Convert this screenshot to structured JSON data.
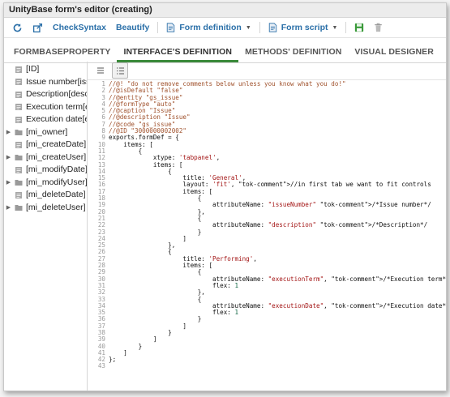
{
  "window": {
    "title": "UnityBase form's editor (creating)"
  },
  "toolbar": {
    "refresh_icon": "refresh-icon",
    "export_icon": "export-icon",
    "check_syntax_label": "CheckSyntax",
    "beautify_label": "Beautify",
    "form_definition_label": "Form definition",
    "form_script_label": "Form script",
    "save_icon": "save-icon",
    "delete_icon": "trash-icon",
    "accent": "#2a6fa8"
  },
  "tabs": [
    {
      "label": "FORMBASEPROPERTY",
      "active": false
    },
    {
      "label": "INTERFACE'S DEFINITION",
      "active": true
    },
    {
      "label": "METHODS' DEFINITION",
      "active": false
    },
    {
      "label": "VISUAL DESIGNER",
      "active": false
    }
  ],
  "tree": {
    "items": [
      {
        "label": "[ID]",
        "expandable": false
      },
      {
        "label": "Issue number[issu",
        "expandable": false
      },
      {
        "label": "Description[descri",
        "expandable": false
      },
      {
        "label": "Execution term[ex",
        "expandable": false
      },
      {
        "label": "Execution date[exe",
        "expandable": false
      },
      {
        "label": "[mi_owner]",
        "expandable": true
      },
      {
        "label": "[mi_createDate]",
        "expandable": false
      },
      {
        "label": "[mi_createUser]",
        "expandable": true
      },
      {
        "label": "[mi_modifyDate]",
        "expandable": false
      },
      {
        "label": "[mi_modifyUser]",
        "expandable": true
      },
      {
        "label": "[mi_deleteDate]",
        "expandable": false
      },
      {
        "label": "[mi_deleteUser]",
        "expandable": true
      }
    ]
  },
  "editor": {
    "code_lines": [
      "//@! \"do not remove comments below unless you know what you do!\"",
      "//@isDefault \"false\"",
      "//@entity \"gs_issue\"",
      "//@formType \"auto\"",
      "//@caption \"Issue\"",
      "//@description \"Issue\"",
      "//@code \"gs_issue\"",
      "//@ID \"3000000002002\"",
      "exports.formDef = {",
      "    items: [",
      "        {",
      "            xtype: 'tabpanel',",
      "            items: [",
      "                {",
      "                    title: 'General',",
      "                    layout: 'fit', //in first tab we want to fit controls",
      "                    items: [",
      "                        {",
      "                            attributeName: \"issueNumber\" /*Issue number*/",
      "                        },",
      "                        {",
      "                            attributeName: \"description\" /*Description*/",
      "                        }",
      "                    ]",
      "                },",
      "                {",
      "                    title: 'Performing',",
      "                    items: [",
      "                        {",
      "                            attributeName: \"executionTerm\", /*Execution term*/",
      "                            flex: 1",
      "                        },",
      "                        {",
      "                            attributeName: \"executionDate\", /*Execution date*/",
      "                            flex: 1",
      "                        }",
      "                    ]",
      "                }",
      "            ]",
      "        }",
      "    ]",
      "};",
      ""
    ]
  },
  "colors": {
    "active_tab_underline": "#3a8a3a",
    "comment": "#a0522d",
    "string": "#a31515",
    "number": "#116644"
  }
}
